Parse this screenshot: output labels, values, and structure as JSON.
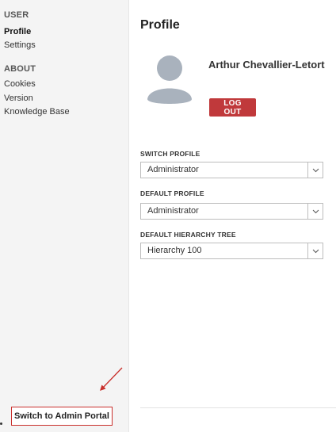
{
  "sidebar": {
    "sections": [
      {
        "heading": "USER",
        "items": [
          {
            "label": "Profile",
            "active": true
          },
          {
            "label": "Settings",
            "active": false
          }
        ]
      },
      {
        "heading": "ABOUT",
        "items": [
          {
            "label": "Cookies"
          },
          {
            "label": "Version"
          },
          {
            "label": "Knowledge Base"
          }
        ]
      }
    ],
    "admin_button": "Switch to Admin Portal"
  },
  "main": {
    "title": "Profile",
    "user_name": "Arthur Chevallier-Letort",
    "logout_label": "LOG OUT",
    "fields": [
      {
        "label": "SWITCH PROFILE",
        "value": "Administrator"
      },
      {
        "label": "DEFAULT PROFILE",
        "value": "Administrator"
      },
      {
        "label": "DEFAULT HIERARCHY TREE",
        "value": "Hierarchy 100"
      }
    ]
  },
  "colors": {
    "accent_red": "#c0393b",
    "sidebar_bg": "#f4f4f4",
    "annotation_red": "#c9302c"
  }
}
